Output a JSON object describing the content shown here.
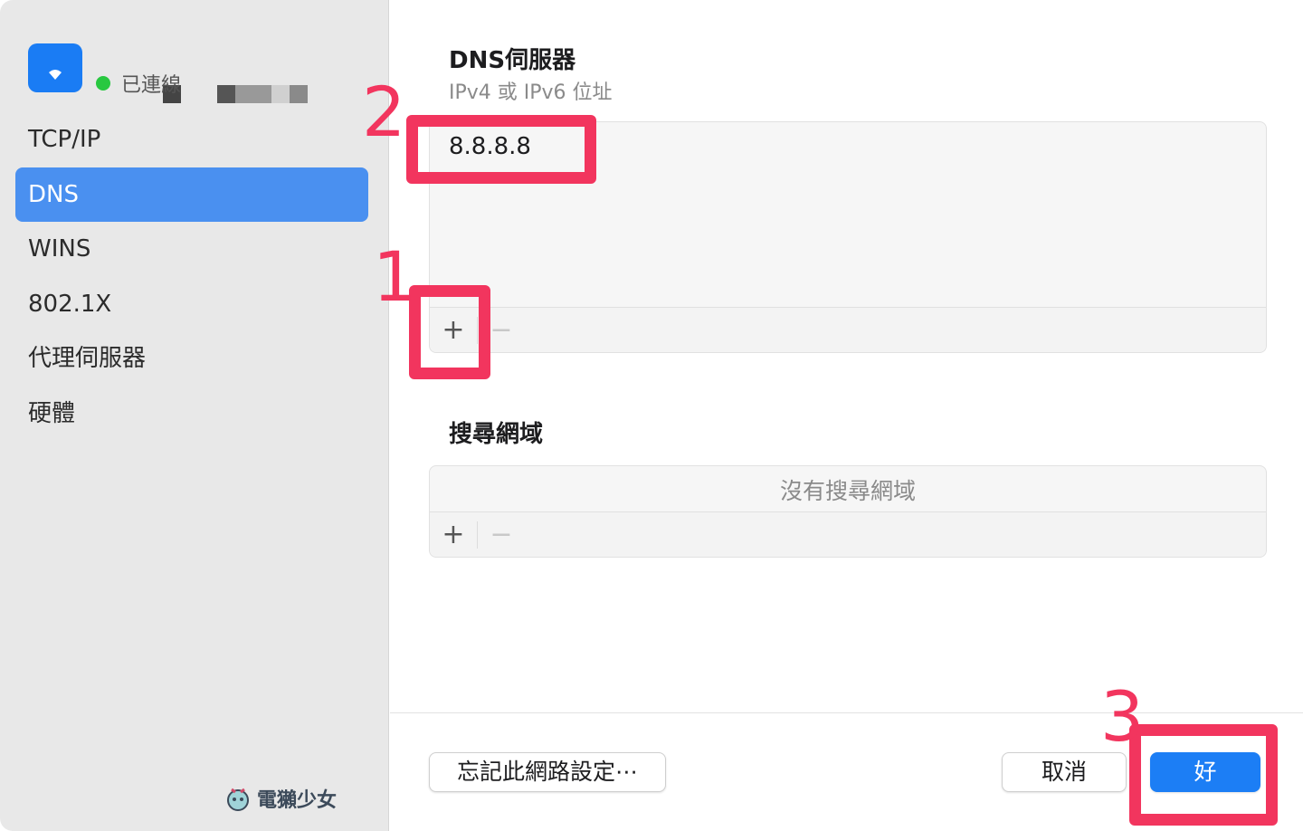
{
  "sidebar": {
    "connection_status": "已連線",
    "items": [
      {
        "label": "TCP/IP",
        "active": false
      },
      {
        "label": "DNS",
        "active": true
      },
      {
        "label": "WINS",
        "active": false
      },
      {
        "label": "802.1X",
        "active": false
      },
      {
        "label": "代理伺服器",
        "active": false
      },
      {
        "label": "硬體",
        "active": false
      }
    ],
    "watermark": "電獺少女"
  },
  "dns": {
    "title": "DNS伺服器",
    "subtitle": "IPv4 或 IPv6 位址",
    "entries": [
      "8.8.8.8"
    ],
    "add_label": "+",
    "remove_label": "−"
  },
  "search_domains": {
    "title": "搜尋網域",
    "empty_message": "沒有搜尋網域",
    "add_label": "+",
    "remove_label": "−"
  },
  "footer": {
    "forget_label": "忘記此網路設定⋯",
    "cancel_label": "取消",
    "ok_label": "好"
  },
  "annotations": {
    "step1": "1",
    "step2": "2",
    "step3": "3",
    "color": "#f2355e"
  },
  "colors": {
    "accent": "#1c7ef5",
    "selection": "#4a90f0",
    "connected": "#28c840"
  }
}
